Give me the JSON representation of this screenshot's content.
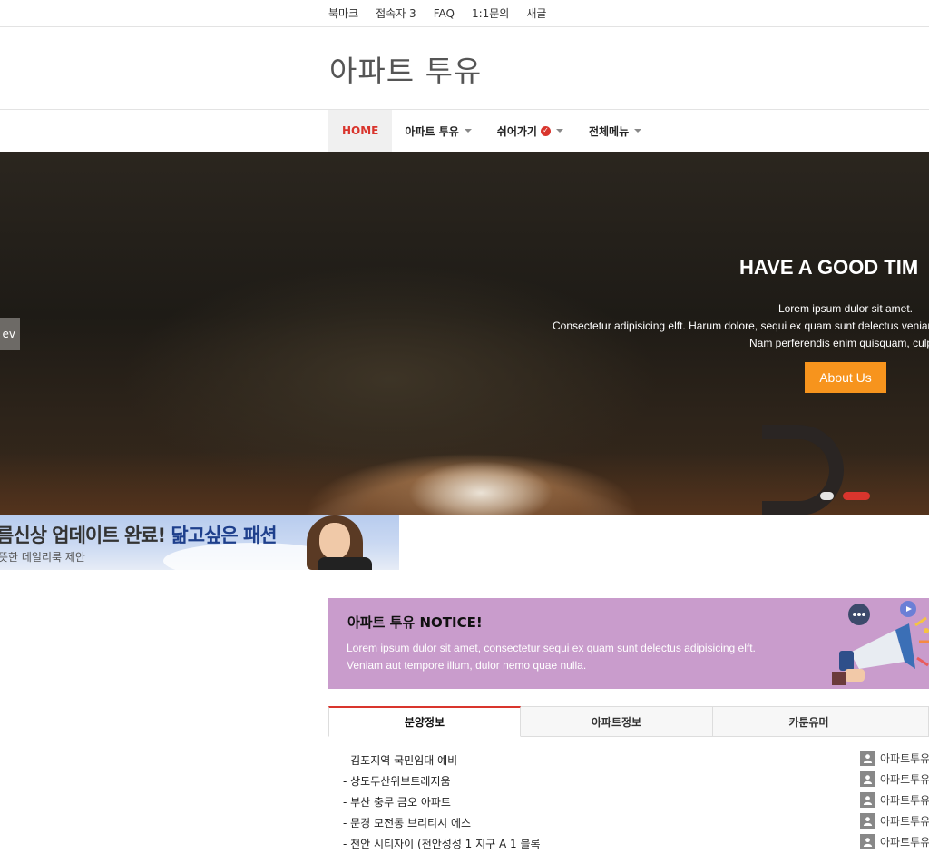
{
  "topbar": {
    "links": [
      "북마크",
      "접속자 3",
      "FAQ",
      "1:1문의",
      "새글"
    ]
  },
  "site": {
    "title": "아파트 투유"
  },
  "nav": {
    "items": [
      {
        "label": "HOME",
        "active": true
      },
      {
        "label": "아파트 투유"
      },
      {
        "label": "쉬어가기"
      },
      {
        "label": "전체메뉴"
      }
    ]
  },
  "hero": {
    "title": "HAVE A GOOD TIM",
    "line1": "Lorem ipsum dulor sit amet.",
    "line2": "Consectetur adipisicing elft. Harum dolore, sequi ex quam sunt delectus veniar",
    "line3": "Nam perferendis enim quisquam, culp",
    "button": "About Us",
    "prev": "ev"
  },
  "banner": {
    "main_a": "름신상 업데이트 완료! ",
    "main_b": "닮고싶은 패션",
    "sub": "뜻한 데일리룩 제안"
  },
  "notice": {
    "title": "아파트 투유 NOTICE!",
    "line1": "Lorem ipsum dulor sit amet, consectetur sequi ex quam sunt delectus adipisicing elft.",
    "line2": "Veniam aut tempore illum, dulor nemo quae nulla."
  },
  "tabs": [
    "분양정보",
    "아파트정보",
    "카툰유머"
  ],
  "posts": [
    {
      "title": "- 김포지역 국민임대 예비",
      "author": "아파트투유"
    },
    {
      "title": "- 상도두산위브트레지움",
      "author": "아파트투유"
    },
    {
      "title": "- 부산   충무   금오   아파트",
      "author": "아파트투유"
    },
    {
      "title": "- 문경   모전동   브리티시   에스",
      "author": "아파트투유"
    },
    {
      "title": "- 천안   시티자이 (천안성성 1 지구    A 1 블록",
      "author": "아파트투유"
    }
  ],
  "colors": {
    "accent": "#d9352d",
    "button": "#f7941d",
    "notice_bg": "#c99ccc"
  }
}
